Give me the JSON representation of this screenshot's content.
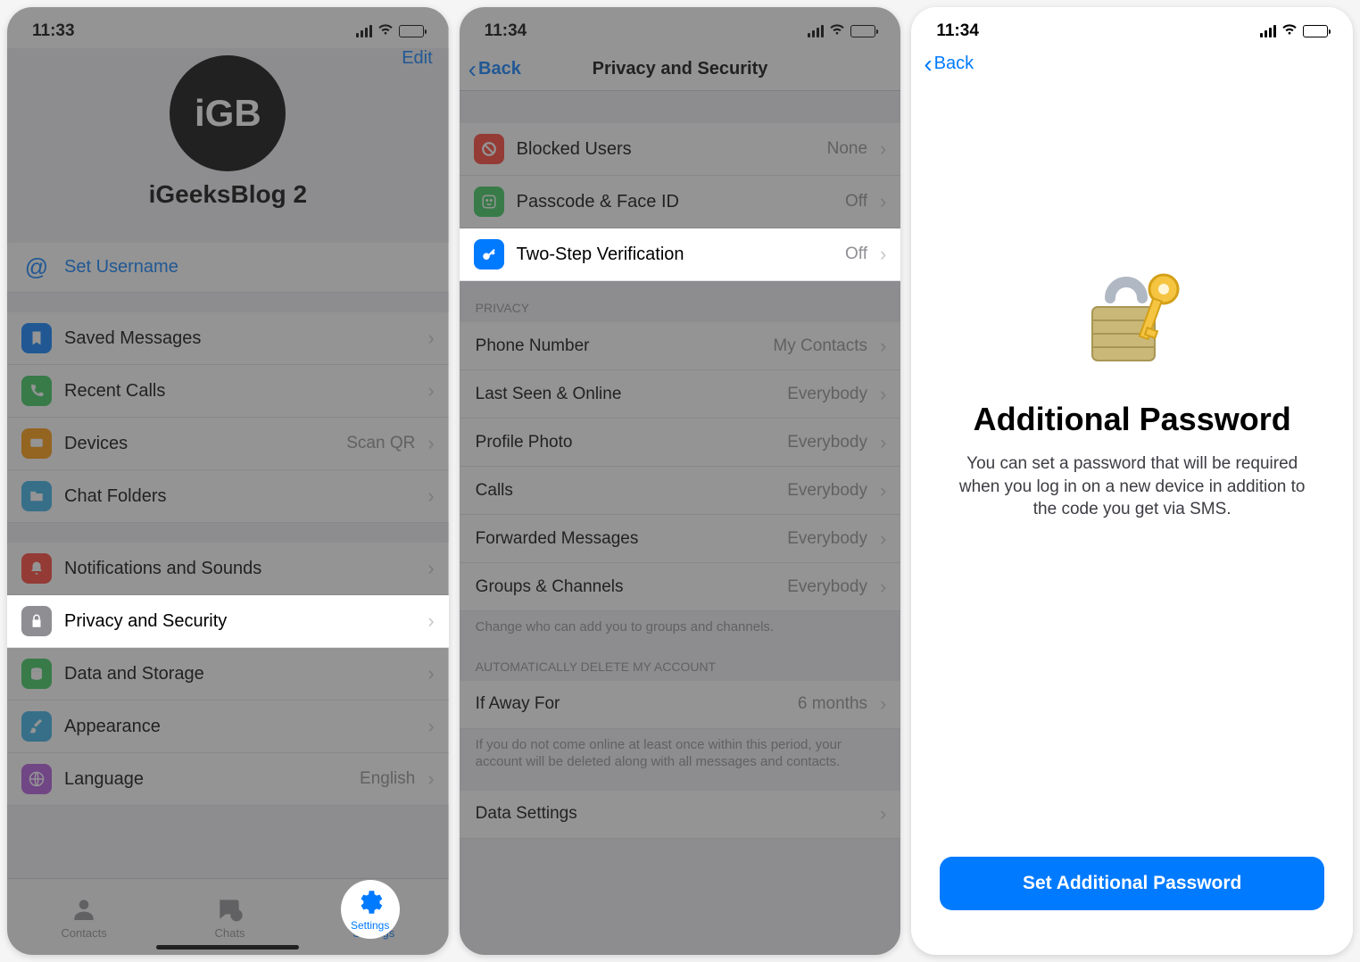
{
  "screen1": {
    "time": "11:33",
    "edit_label": "Edit",
    "avatar_text": "iGB",
    "profile_name": "iGeeksBlog 2",
    "set_username": "Set Username",
    "rows": {
      "saved": "Saved Messages",
      "recent": "Recent Calls",
      "devices": "Devices",
      "devices_value": "Scan QR",
      "folders": "Chat Folders",
      "notifications": "Notifications and Sounds",
      "privacy": "Privacy and Security",
      "data": "Data and Storage",
      "appearance": "Appearance",
      "language": "Language",
      "language_value": "English"
    },
    "tabs": {
      "contacts": "Contacts",
      "chats": "Chats",
      "settings": "Settings"
    }
  },
  "screen2": {
    "time": "11:34",
    "back": "Back",
    "title": "Privacy and Security",
    "blocked": {
      "label": "Blocked Users",
      "value": "None"
    },
    "passcode": {
      "label": "Passcode & Face ID",
      "value": "Off"
    },
    "twostep": {
      "label": "Two-Step Verification",
      "value": "Off"
    },
    "privacy_header": "PRIVACY",
    "phone": {
      "label": "Phone Number",
      "value": "My Contacts"
    },
    "lastseen": {
      "label": "Last Seen & Online",
      "value": "Everybody"
    },
    "photo": {
      "label": "Profile Photo",
      "value": "Everybody"
    },
    "calls": {
      "label": "Calls",
      "value": "Everybody"
    },
    "forwarded": {
      "label": "Forwarded Messages",
      "value": "Everybody"
    },
    "groups": {
      "label": "Groups & Channels",
      "value": "Everybody"
    },
    "privacy_footer": "Change who can add you to groups and channels.",
    "delete_header": "AUTOMATICALLY DELETE MY ACCOUNT",
    "away": {
      "label": "If Away For",
      "value": "6 months"
    },
    "delete_footer": "If you do not come online at least once within this period, your account will be deleted along with all messages and contacts.",
    "data_settings": "Data Settings"
  },
  "screen3": {
    "time": "11:34",
    "back": "Back",
    "title": "Additional Password",
    "desc": "You can set a password that will be required when you log in on a new device in addition to the code you get via SMS.",
    "button": "Set Additional Password"
  }
}
